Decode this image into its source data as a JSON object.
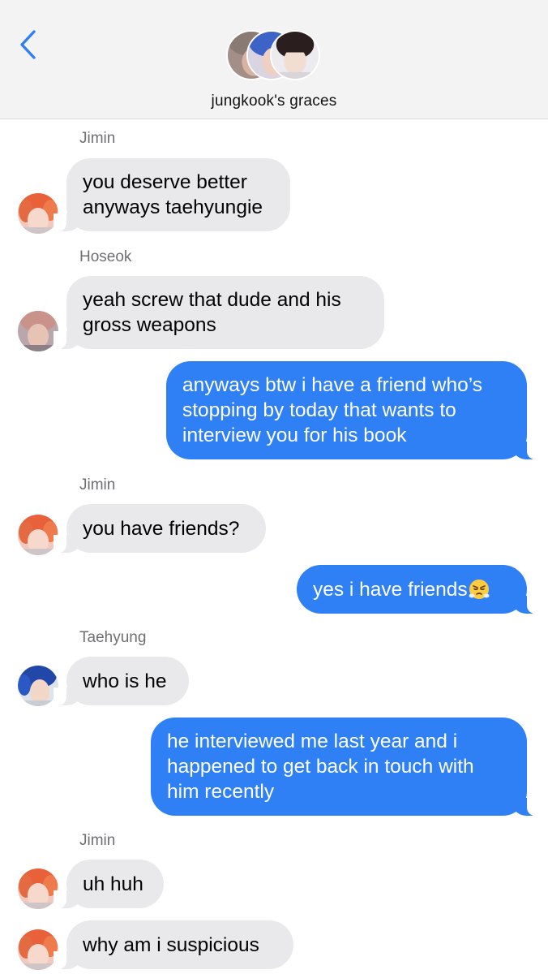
{
  "header": {
    "back_icon": "chevron-left-icon",
    "group_name": "jungkook's graces",
    "accent_color": "#2f80f5"
  },
  "messages": [
    {
      "sender": "Jimin",
      "direction": "incoming",
      "lines": [
        "you deserve better",
        "anyways taehyungie"
      ]
    },
    {
      "sender": "Hoseok",
      "direction": "incoming",
      "lines": [
        "yeah screw that dude and his",
        "gross weapons"
      ]
    },
    {
      "sender": "",
      "direction": "outgoing",
      "lines": [
        "anyways btw i have a friend who’s",
        "stopping by today that wants to",
        "interview you for his book"
      ]
    },
    {
      "sender": "Jimin",
      "direction": "incoming",
      "lines": [
        "you have friends?"
      ]
    },
    {
      "sender": "",
      "direction": "outgoing",
      "lines": [
        "yes i have friends"
      ],
      "emoji": "angry-huffing-face"
    },
    {
      "sender": "Taehyung",
      "direction": "incoming",
      "lines": [
        "who is he"
      ]
    },
    {
      "sender": "",
      "direction": "outgoing",
      "lines": [
        "he interviewed me last year and i",
        "happened to get back in touch with",
        "him recently"
      ]
    },
    {
      "sender": "Jimin",
      "direction": "incoming",
      "lines": [
        "uh huh"
      ]
    },
    {
      "sender": "",
      "direction": "incoming",
      "lines": [
        "why am i suspicious"
      ]
    }
  ]
}
